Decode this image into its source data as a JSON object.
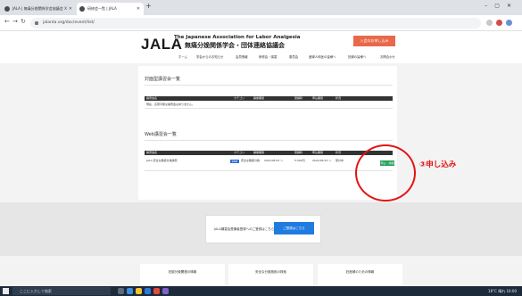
{
  "browser": {
    "tabs": [
      {
        "label": "JALA | 無痛分娩関係学会協議会 X"
      },
      {
        "label": "研修会一覧 | JALA"
      }
    ],
    "url": "jalanta.org/doc/event/list/"
  },
  "header": {
    "logo": "JALA",
    "logo_en": "The Japanese Association for Labor Analgesia",
    "logo_ja": "無痛分娩関係学会・団体連絡協議会",
    "join_button": "入会のお申し込み",
    "nav": [
      "ホーム",
      "学会からのお知らせ",
      "会員情報",
      "研修会・講習",
      "委員会",
      "産婦人科医の皆様へ",
      "妊婦の皆様へ",
      "お問合わせ"
    ]
  },
  "section1": {
    "title": "対面型講習会一覧",
    "columns": [
      "講習会名",
      "カテゴリ",
      "開催期間",
      "受講料",
      "申込期間",
      "状況"
    ],
    "empty_text": "現在、応募可能な講習会はありません。"
  },
  "section2": {
    "title": "Web講習会一覧",
    "columns": [
      "講習会名",
      "カテゴリ",
      "開催期間",
      "受講料",
      "申込期間",
      "状況"
    ],
    "rows": [
      {
        "name": "JALA 安全な無痛分娩講習",
        "badge": "WEB",
        "category": "安全な無痛分娩",
        "period": "2021/05/13 〜",
        "fee": "5,500円",
        "apply": "2021/05/13 〜",
        "status": "受付中",
        "action": "申込・詳細"
      }
    ]
  },
  "annotation": {
    "callout": "③申し込み",
    "color": "#e41313"
  },
  "registration": {
    "text": "JALA講習会受講者登録へのご登録はこちら",
    "button": "ご登録はこちら"
  },
  "footer": {
    "cards": [
      "妊娠分娩関連の情報",
      "安全な分娩施設の検索",
      "妊産婦のための情報"
    ]
  },
  "taskbar": {
    "search": "ここに入力して検索",
    "tray": "16°C 晴れ 16:00"
  },
  "colors": {
    "accent_orange": "#e9684a",
    "link_blue": "#1f7be0",
    "ok_green": "#24a05a"
  }
}
